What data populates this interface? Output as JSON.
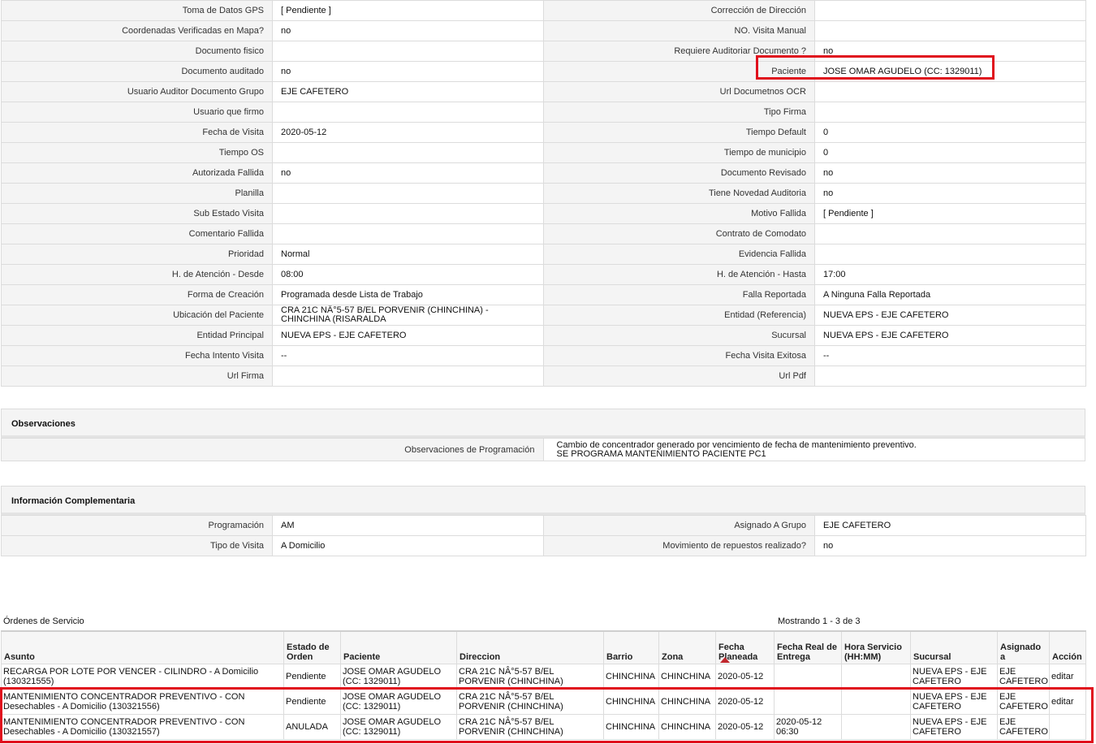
{
  "detail_rows": [
    {
      "l1": "Toma de Datos GPS",
      "v1": "[ Pendiente ]",
      "l2": "Corrección de Dirección",
      "v2": ""
    },
    {
      "l1": "Coordenadas Verificadas en Mapa?",
      "v1": " no",
      "l2": "NO. Visita Manual",
      "v2": ""
    },
    {
      "l1": "Documento fisico",
      "v1": "",
      "l2": "Requiere Auditoriar Documento ?",
      "v2": " no"
    },
    {
      "l1": "Documento auditado",
      "v1": " no",
      "l2": "Paciente",
      "v2": "JOSE OMAR AGUDELO (CC: 1329011)"
    },
    {
      "l1": "Usuario Auditor Documento Grupo",
      "v1": "EJE CAFETERO",
      "l2": "Url Documetnos OCR",
      "v2": ""
    },
    {
      "l1": "Usuario que firmo",
      "v1": "",
      "l2": "Tipo Firma",
      "v2": ""
    },
    {
      "l1": "Fecha de Visita",
      "v1": " 2020-05-12",
      "l2": "Tiempo Default",
      "v2": "0"
    },
    {
      "l1": "Tiempo OS",
      "v1": "",
      "l2": "Tiempo de municipio",
      "v2": "0"
    },
    {
      "l1": "Autorizada Fallida",
      "v1": " no",
      "l2": "Documento Revisado",
      "v2": " no"
    },
    {
      "l1": "Planilla",
      "v1": "",
      "l2": "Tiene Novedad Auditoria",
      "v2": " no"
    },
    {
      "l1": "Sub Estado Visita",
      "v1": "",
      "l2": "Motivo Fallida",
      "v2": "[ Pendiente ]"
    },
    {
      "l1": "Comentario Fallida",
      "v1": "",
      "l2": "Contrato de Comodato",
      "v2": ""
    },
    {
      "l1": "Prioridad",
      "v1": "Normal",
      "l2": "Evidencia Fallida",
      "v2": ""
    },
    {
      "l1": "H. de Atención - Desde",
      "v1": "08:00",
      "l2": "H. de Atención - Hasta",
      "v2": "17:00"
    },
    {
      "l1": "Forma de Creación",
      "v1": "Programada desde Lista de Trabajo",
      "l2": "Falla Reportada",
      "v2": "A Ninguna Falla Reportada"
    },
    {
      "l1": "Ubicación del Paciente",
      "v1": "CRA 21C NÂ°5-57 B/EL PORVENIR (CHINCHINA) - CHINCHINA (RISARALDA",
      "l2": "Entidad (Referencia)",
      "v2": "NUEVA EPS - EJE CAFETERO"
    },
    {
      "l1": "Entidad Principal",
      "v1": "NUEVA EPS - EJE CAFETERO",
      "l2": "Sucursal",
      "v2": "NUEVA EPS - EJE CAFETERO"
    },
    {
      "l1": "Fecha Intento Visita",
      "v1": "--",
      "l2": "Fecha Visita Exitosa",
      "v2": " --"
    },
    {
      "l1": "Url Firma",
      "v1": "",
      "l2": "Url Pdf",
      "v2": ""
    }
  ],
  "observaciones": {
    "title": "Observaciones",
    "label": "Observaciones de Programación",
    "line1": "Cambio de concentrador generado por vencimiento de fecha de mantenimiento preventivo.",
    "line2": "SE PROGRAMA MANTENIMIENTO PACIENTE PC1"
  },
  "complementaria": {
    "title": "Información Complementaria",
    "rows": [
      {
        "l1": "Programación",
        "v1": "AM",
        "l2": "Asignado A Grupo",
        "v2": "EJE CAFETERO"
      },
      {
        "l1": "Tipo de Visita",
        "v1": "A Domicilio",
        "l2": "Movimiento de repuestos realizado?",
        "v2": " no"
      }
    ]
  },
  "orders": {
    "title": "Órdenes de Servicio",
    "count": "Mostrando 1 - 3 de 3",
    "headers": [
      "Asunto",
      "Estado de Orden",
      "Paciente",
      "Direccion",
      "Barrio",
      "Zona",
      "Fecha Planeada",
      "Fecha Real de Entrega",
      "Hora Servicio (HH:MM)",
      "Sucursal",
      "Asignado a",
      "Acción"
    ],
    "rows": [
      {
        "asunto": "RECARGA POR LOTE POR VENCER - CILINDRO - A Domicilio (130321555)",
        "estado": "Pendiente",
        "paciente": "JOSE OMAR AGUDELO (CC: 1329011)",
        "direccion": "CRA 21C NÂ°5-57 B/EL PORVENIR (CHINCHINA)",
        "barrio": "CHINCHINA",
        "zona": "CHINCHINA",
        "fecha_planeada": "2020-05-12",
        "fecha_real": "",
        "hora": "",
        "sucursal": "NUEVA EPS - EJE CAFETERO",
        "asignado": "EJE CAFETERO",
        "accion": "editar"
      },
      {
        "asunto": "MANTENIMIENTO CONCENTRADOR PREVENTIVO - CON Desechables - A Domicilio (130321556)",
        "estado": "Pendiente",
        "paciente": "JOSE OMAR AGUDELO (CC: 1329011)",
        "direccion": "CRA 21C NÂ°5-57 B/EL PORVENIR (CHINCHINA)",
        "barrio": "CHINCHINA",
        "zona": "CHINCHINA",
        "fecha_planeada": "2020-05-12",
        "fecha_real": "",
        "hora": "",
        "sucursal": "NUEVA EPS - EJE CAFETERO",
        "asignado": "EJE CAFETERO",
        "accion": "editar"
      },
      {
        "asunto": "MANTENIMIENTO CONCENTRADOR PREVENTIVO - CON Desechables - A Domicilio (130321557)",
        "estado": "ANULADA",
        "paciente": "JOSE OMAR AGUDELO (CC: 1329011)",
        "direccion": "CRA 21C NÂ°5-57 B/EL PORVENIR (CHINCHINA)",
        "barrio": "CHINCHINA",
        "zona": "CHINCHINA",
        "fecha_planeada": "2020-05-12",
        "fecha_real": "2020-05-12 06:30",
        "hora": "",
        "sucursal": "NUEVA EPS - EJE CAFETERO",
        "asignado": "EJE CAFETERO",
        "accion": ""
      }
    ]
  },
  "colors": {
    "highlight": "#e0101d",
    "label_bg": "#f4f4f4",
    "border": "#dcdcdc"
  }
}
